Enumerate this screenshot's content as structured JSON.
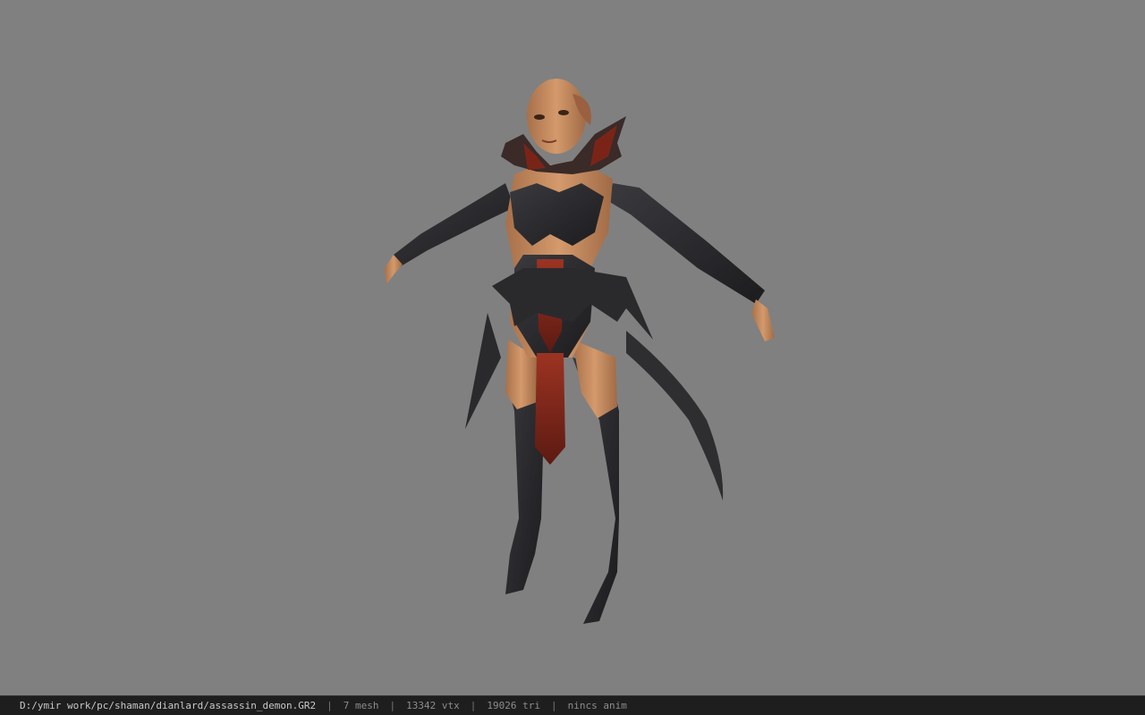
{
  "viewport": {
    "background_color": "#808080",
    "model": {
      "skin_color": "#c58a5e",
      "armor_dark": "#2b2b2e",
      "armor_red": "#8a2a1e"
    }
  },
  "statusbar": {
    "file_path": "D:/ymir work/pc/shaman/dianlard/assassin_demon.GR2",
    "separator": "|",
    "mesh_count": "7 mesh",
    "vertex_count": "13342 vtx",
    "triangle_count": "19026 tri",
    "anim_info": "nincs anim"
  }
}
